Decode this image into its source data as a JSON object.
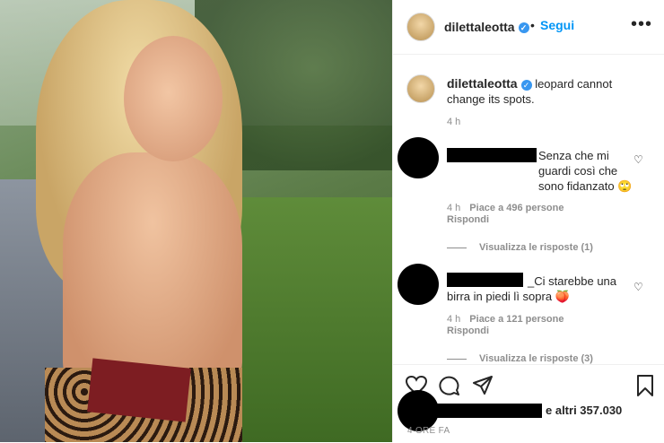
{
  "header": {
    "username": "dilettaleotta",
    "verified_glyph": "✓",
    "dot": "•",
    "follow_label": "Segui",
    "more_glyph": "•••"
  },
  "caption": {
    "username": "dilettaleotta",
    "text": " leopard cannot change its spots.",
    "time": "4 h"
  },
  "comments": [
    {
      "text": "Senza che mi guardi così che sono fidanzato 🙄",
      "time": "4 h",
      "likes": "Piace a 496 persone",
      "reply": "Rispondi",
      "view_replies": "Visualizza le risposte (1)"
    },
    {
      "prefix": "_",
      "text": "Ci starebbe una birra in piedi lì sopra 🍑",
      "time": "4 h",
      "likes": "Piace a 121 persone",
      "reply": "Rispondi",
      "view_replies": "Visualizza le risposte (3)"
    }
  ],
  "footer": {
    "likes_text": "e altri 357.030",
    "time_ago": "4 ORE FA"
  },
  "icons": [
    "heart-icon",
    "comment-icon",
    "share-icon",
    "bookmark-icon",
    "more-icon",
    "verified-icon"
  ]
}
